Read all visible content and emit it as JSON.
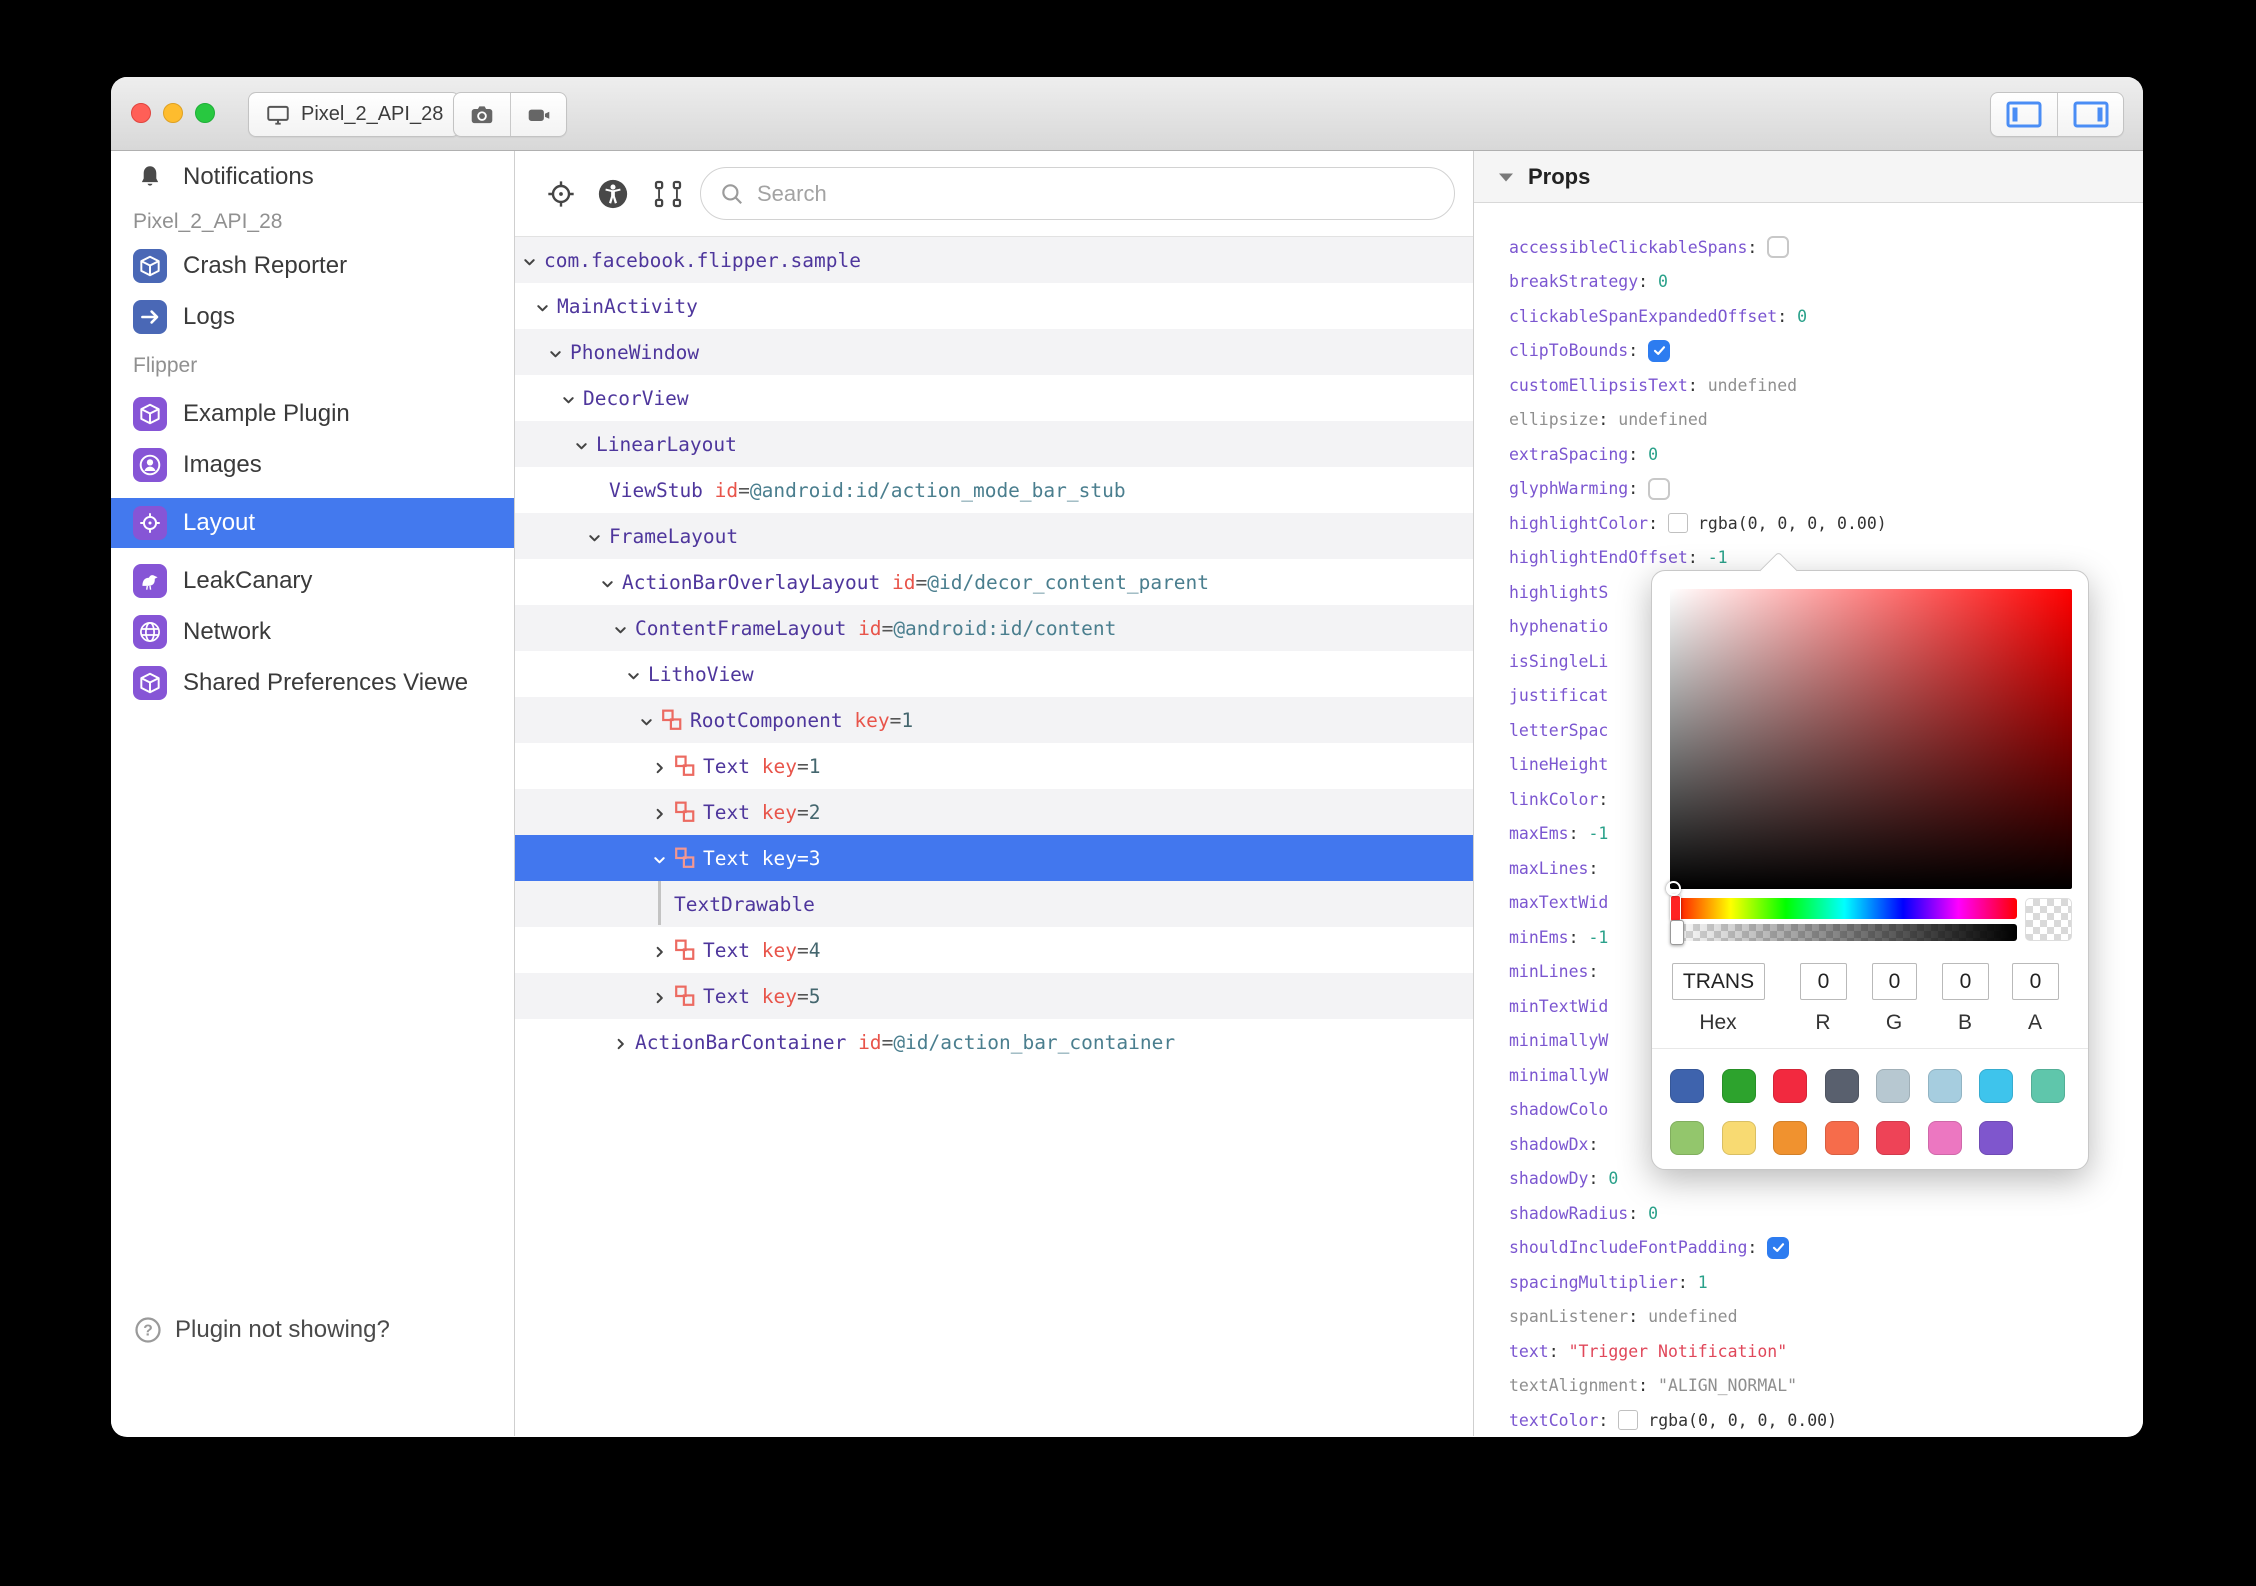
{
  "titlebar": {
    "device_name": "Pixel_2_API_28",
    "icons": {
      "device": "monitor-icon",
      "photo": "camera-icon",
      "record": "video-camera-icon",
      "left_panel": "panel-left-toggle-icon",
      "right_panel": "panel-right-toggle-icon"
    }
  },
  "sidebar": {
    "notifications": {
      "label": "Notifications",
      "icon": "bell-icon"
    },
    "sections": [
      {
        "label": "Pixel_2_API_28",
        "items": [
          {
            "label": "Crash Reporter",
            "icon": "cube-icon",
            "icon_bg": "#4a68b6",
            "selected": false
          },
          {
            "label": "Logs",
            "icon": "arrow-right-icon",
            "icon_bg": "#4a68b6",
            "selected": false
          }
        ]
      },
      {
        "label": "Flipper",
        "items": [
          {
            "label": "Example Plugin",
            "icon": "cube-icon",
            "icon_bg": "#8655d6",
            "selected": false
          },
          {
            "label": "Images",
            "icon": "user-circle-icon",
            "icon_bg": "#8655d6",
            "selected": false
          },
          {
            "label": "Layout",
            "icon": "target-icon",
            "icon_bg": "#8655d6",
            "selected": true
          },
          {
            "label": "LeakCanary",
            "icon": "bird-icon",
            "icon_bg": "#8655d6",
            "selected": false
          },
          {
            "label": "Network",
            "icon": "globe-icon",
            "icon_bg": "#8655d6",
            "selected": false
          },
          {
            "label": "Shared Preferences Viewe",
            "icon": "cube-icon",
            "icon_bg": "#8655d6",
            "selected": false
          }
        ]
      }
    ],
    "help": {
      "label": "Plugin not showing?",
      "icon": "help-circle-icon"
    },
    "selected_bg": "#4379ee"
  },
  "toolbar": {
    "search_placeholder": "Search",
    "icons": {
      "target": "target-crosshair-icon",
      "accessibility": "accessibility-icon",
      "marquee": "select-element-icon"
    }
  },
  "tree": {
    "rows": [
      {
        "label": "com.facebook.flipper.sample",
        "level": 0,
        "chevron": "down"
      },
      {
        "label": "MainActivity",
        "level": 1,
        "chevron": "down"
      },
      {
        "label": "PhoneWindow",
        "level": 2,
        "chevron": "down"
      },
      {
        "label": "DecorView",
        "level": 3,
        "chevron": "down"
      },
      {
        "label": "LinearLayout",
        "level": 4,
        "chevron": "down"
      },
      {
        "label": "ViewStub",
        "level": 5,
        "chevron": "none",
        "attr": {
          "name": "id",
          "value": "@android:id/action_mode_bar_stub",
          "kind": "id"
        }
      },
      {
        "label": "FrameLayout",
        "level": 5,
        "chevron": "down"
      },
      {
        "label": "ActionBarOverlayLayout",
        "level": 6,
        "chevron": "down",
        "attr": {
          "name": "id",
          "value": "@id/decor_content_parent",
          "kind": "id"
        }
      },
      {
        "label": "ContentFrameLayout",
        "level": 7,
        "chevron": "down",
        "attr": {
          "name": "id",
          "value": "@android:id/content",
          "kind": "id"
        }
      },
      {
        "label": "LithoView",
        "level": 8,
        "chevron": "down"
      },
      {
        "label": "RootComponent",
        "level": 9,
        "chevron": "down",
        "icon": "litho-component-icon",
        "attr": {
          "name": "key",
          "value": "1",
          "kind": "key"
        }
      },
      {
        "label": "Text",
        "level": 10,
        "chevron": "right",
        "icon": "litho-component-icon",
        "attr": {
          "name": "key",
          "value": "1",
          "kind": "key"
        }
      },
      {
        "label": "Text",
        "level": 10,
        "chevron": "right",
        "icon": "litho-component-icon",
        "attr": {
          "name": "key",
          "value": "2",
          "kind": "key"
        }
      },
      {
        "label": "Text",
        "level": 10,
        "chevron": "down",
        "icon": "litho-component-icon",
        "selected": true,
        "attr": {
          "name": "key",
          "value": "3",
          "kind": "key"
        }
      },
      {
        "label": "TextDrawable",
        "level": 10,
        "chevron": "guide"
      },
      {
        "label": "Text",
        "level": 10,
        "chevron": "right",
        "icon": "litho-component-icon",
        "attr": {
          "name": "key",
          "value": "4",
          "kind": "key"
        }
      },
      {
        "label": "Text",
        "level": 10,
        "chevron": "right",
        "icon": "litho-component-icon",
        "attr": {
          "name": "key",
          "value": "5",
          "kind": "key"
        }
      },
      {
        "label": "ActionBarContainer",
        "level": 7,
        "chevron": "right",
        "attr": {
          "name": "id",
          "value": "@id/action_bar_container",
          "kind": "id"
        }
      }
    ]
  },
  "props": {
    "header": "Props",
    "rows": [
      {
        "key": "accessibleClickableSpans",
        "type": "checkbox",
        "checked": false
      },
      {
        "key": "breakStrategy",
        "type": "number",
        "value": "0"
      },
      {
        "key": "clickableSpanExpandedOffset",
        "type": "number",
        "value": "0"
      },
      {
        "key": "clipToBounds",
        "type": "checkbox",
        "checked": true
      },
      {
        "key": "customEllipsisText",
        "type": "undefined",
        "value": "undefined"
      },
      {
        "key": "ellipsize",
        "gray": true,
        "type": "undefined",
        "value": "undefined"
      },
      {
        "key": "extraSpacing",
        "type": "number",
        "value": "0"
      },
      {
        "key": "glyphWarming",
        "type": "checkbox",
        "checked": false
      },
      {
        "key": "highlightColor",
        "type": "color",
        "value": "rgba(0, 0, 0, 0.00)"
      },
      {
        "key": "highlightEndOffset",
        "type": "number",
        "value": "-1"
      },
      {
        "key": "highlightS",
        "type": "fragment"
      },
      {
        "key": "hyphenatio",
        "type": "fragment"
      },
      {
        "key": "isSingleLi",
        "type": "fragment"
      },
      {
        "key": "justificat",
        "type": "fragment"
      },
      {
        "key": "letterSpac",
        "type": "fragment"
      },
      {
        "key": "lineHeight",
        "type": "fragment"
      },
      {
        "key": "linkColor:",
        "type": "fragment"
      },
      {
        "key": "maxEms",
        "type": "number",
        "value": "-1"
      },
      {
        "key": "maxLines:",
        "type": "fragment"
      },
      {
        "key": "maxTextWid",
        "type": "fragment"
      },
      {
        "key": "minEms",
        "type": "number",
        "value": "-1"
      },
      {
        "key": "minLines:",
        "type": "fragment"
      },
      {
        "key": "minTextWid",
        "type": "fragment"
      },
      {
        "key": "minimallyW",
        "type": "fragment"
      },
      {
        "key": "minimallyW",
        "type": "fragment"
      },
      {
        "key": "shadowColo",
        "type": "fragment"
      },
      {
        "key": "shadowDx:",
        "type": "fragment"
      },
      {
        "key": "shadowDy",
        "type": "number",
        "value": "0"
      },
      {
        "key": "shadowRadius",
        "type": "number",
        "value": "0"
      },
      {
        "key": "shouldIncludeFontPadding",
        "type": "checkbox",
        "checked": true
      },
      {
        "key": "spacingMultiplier",
        "type": "number",
        "value": "1"
      },
      {
        "key": "spanListener",
        "gray": true,
        "type": "undefined",
        "value": "undefined"
      },
      {
        "key": "text",
        "type": "string-red",
        "value": "\"Trigger Notification\""
      },
      {
        "key": "textAlignment",
        "gray": true,
        "type": "string-gray",
        "value": "\"ALIGN_NORMAL\""
      },
      {
        "key": "textColor",
        "type": "color",
        "value": "rgba(0, 0, 0, 0.00)"
      }
    ]
  },
  "color_picker": {
    "hex_value": "TRANS",
    "r_value": "0",
    "g_value": "0",
    "b_value": "0",
    "a_value": "0",
    "hex_label": "Hex",
    "r_label": "R",
    "g_label": "G",
    "b_label": "B",
    "a_label": "A",
    "swatches_row1": [
      "#3e63ad",
      "#2da32d",
      "#f2293f",
      "#59606e",
      "#b7c8d1",
      "#a6cddf",
      "#3ec4ec",
      "#5fc6ab"
    ],
    "swatches_row2": [
      "#93c66c",
      "#f8da72",
      "#f0922f",
      "#f66c4b",
      "#ee4357",
      "#ec77c1",
      "#7f56cd"
    ]
  }
}
